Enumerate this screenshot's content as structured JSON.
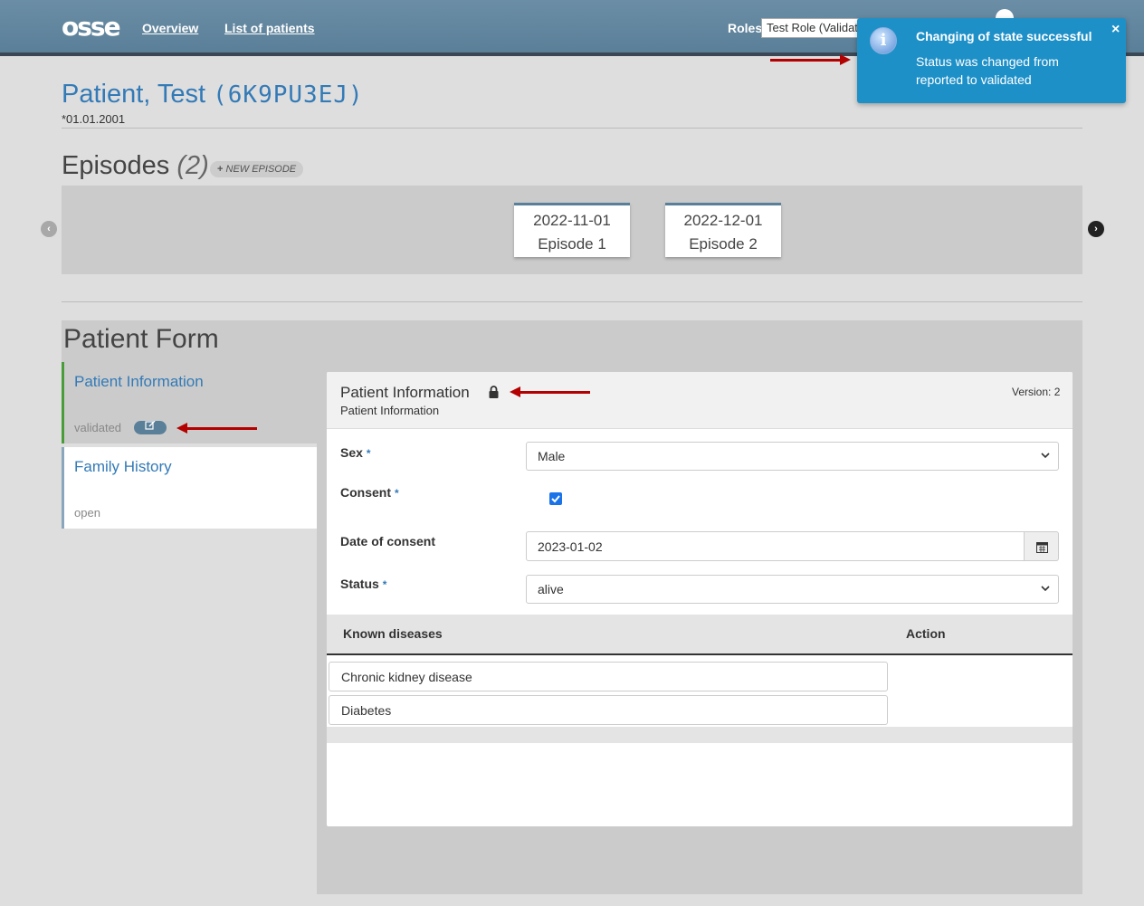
{
  "header": {
    "logo": "osse",
    "nav": [
      {
        "label": "Overview"
      },
      {
        "label": "List of patients"
      }
    ],
    "roles_label": "Roles",
    "roles_selected": "Test Role (Validator)"
  },
  "toast": {
    "title": "Changing of state successful",
    "body": "Status was changed from reported to validated",
    "close": "×",
    "icon": "info-icon"
  },
  "patient": {
    "name": "Patient, Test",
    "code": "(6K9PU3EJ)",
    "dob": "*01.01.2001"
  },
  "episodes": {
    "heading": "Episodes",
    "count": "(2)",
    "new_label": "NEW EPISODE",
    "items": [
      {
        "date": "2022-11-01",
        "name": "Episode 1"
      },
      {
        "date": "2022-12-01",
        "name": "Episode 2"
      }
    ]
  },
  "form": {
    "title": "Patient Form",
    "sections": [
      {
        "label": "Patient Information",
        "state": "validated"
      },
      {
        "label": "Family History",
        "state": "open"
      }
    ],
    "panel": {
      "title": "Patient Information",
      "subtitle": "Patient Information",
      "version": "Version: 2",
      "fields": {
        "sex_label": "Sex",
        "sex_value": "Male",
        "consent_label": "Consent",
        "consent_checked": true,
        "date_label": "Date of consent",
        "date_value": "2023-01-02",
        "status_label": "Status",
        "status_value": "alive",
        "required_mark": "*"
      },
      "table": {
        "headers": [
          "Known diseases",
          "Action"
        ],
        "rows": [
          "Chronic kidney disease",
          "Diabetes"
        ]
      }
    }
  },
  "colors": {
    "accent": "#337ab7",
    "header": "#5a7f98",
    "toast": "#1e90c8",
    "annotation_arrow": "#b30000",
    "validated_border": "#4a9b3a"
  }
}
